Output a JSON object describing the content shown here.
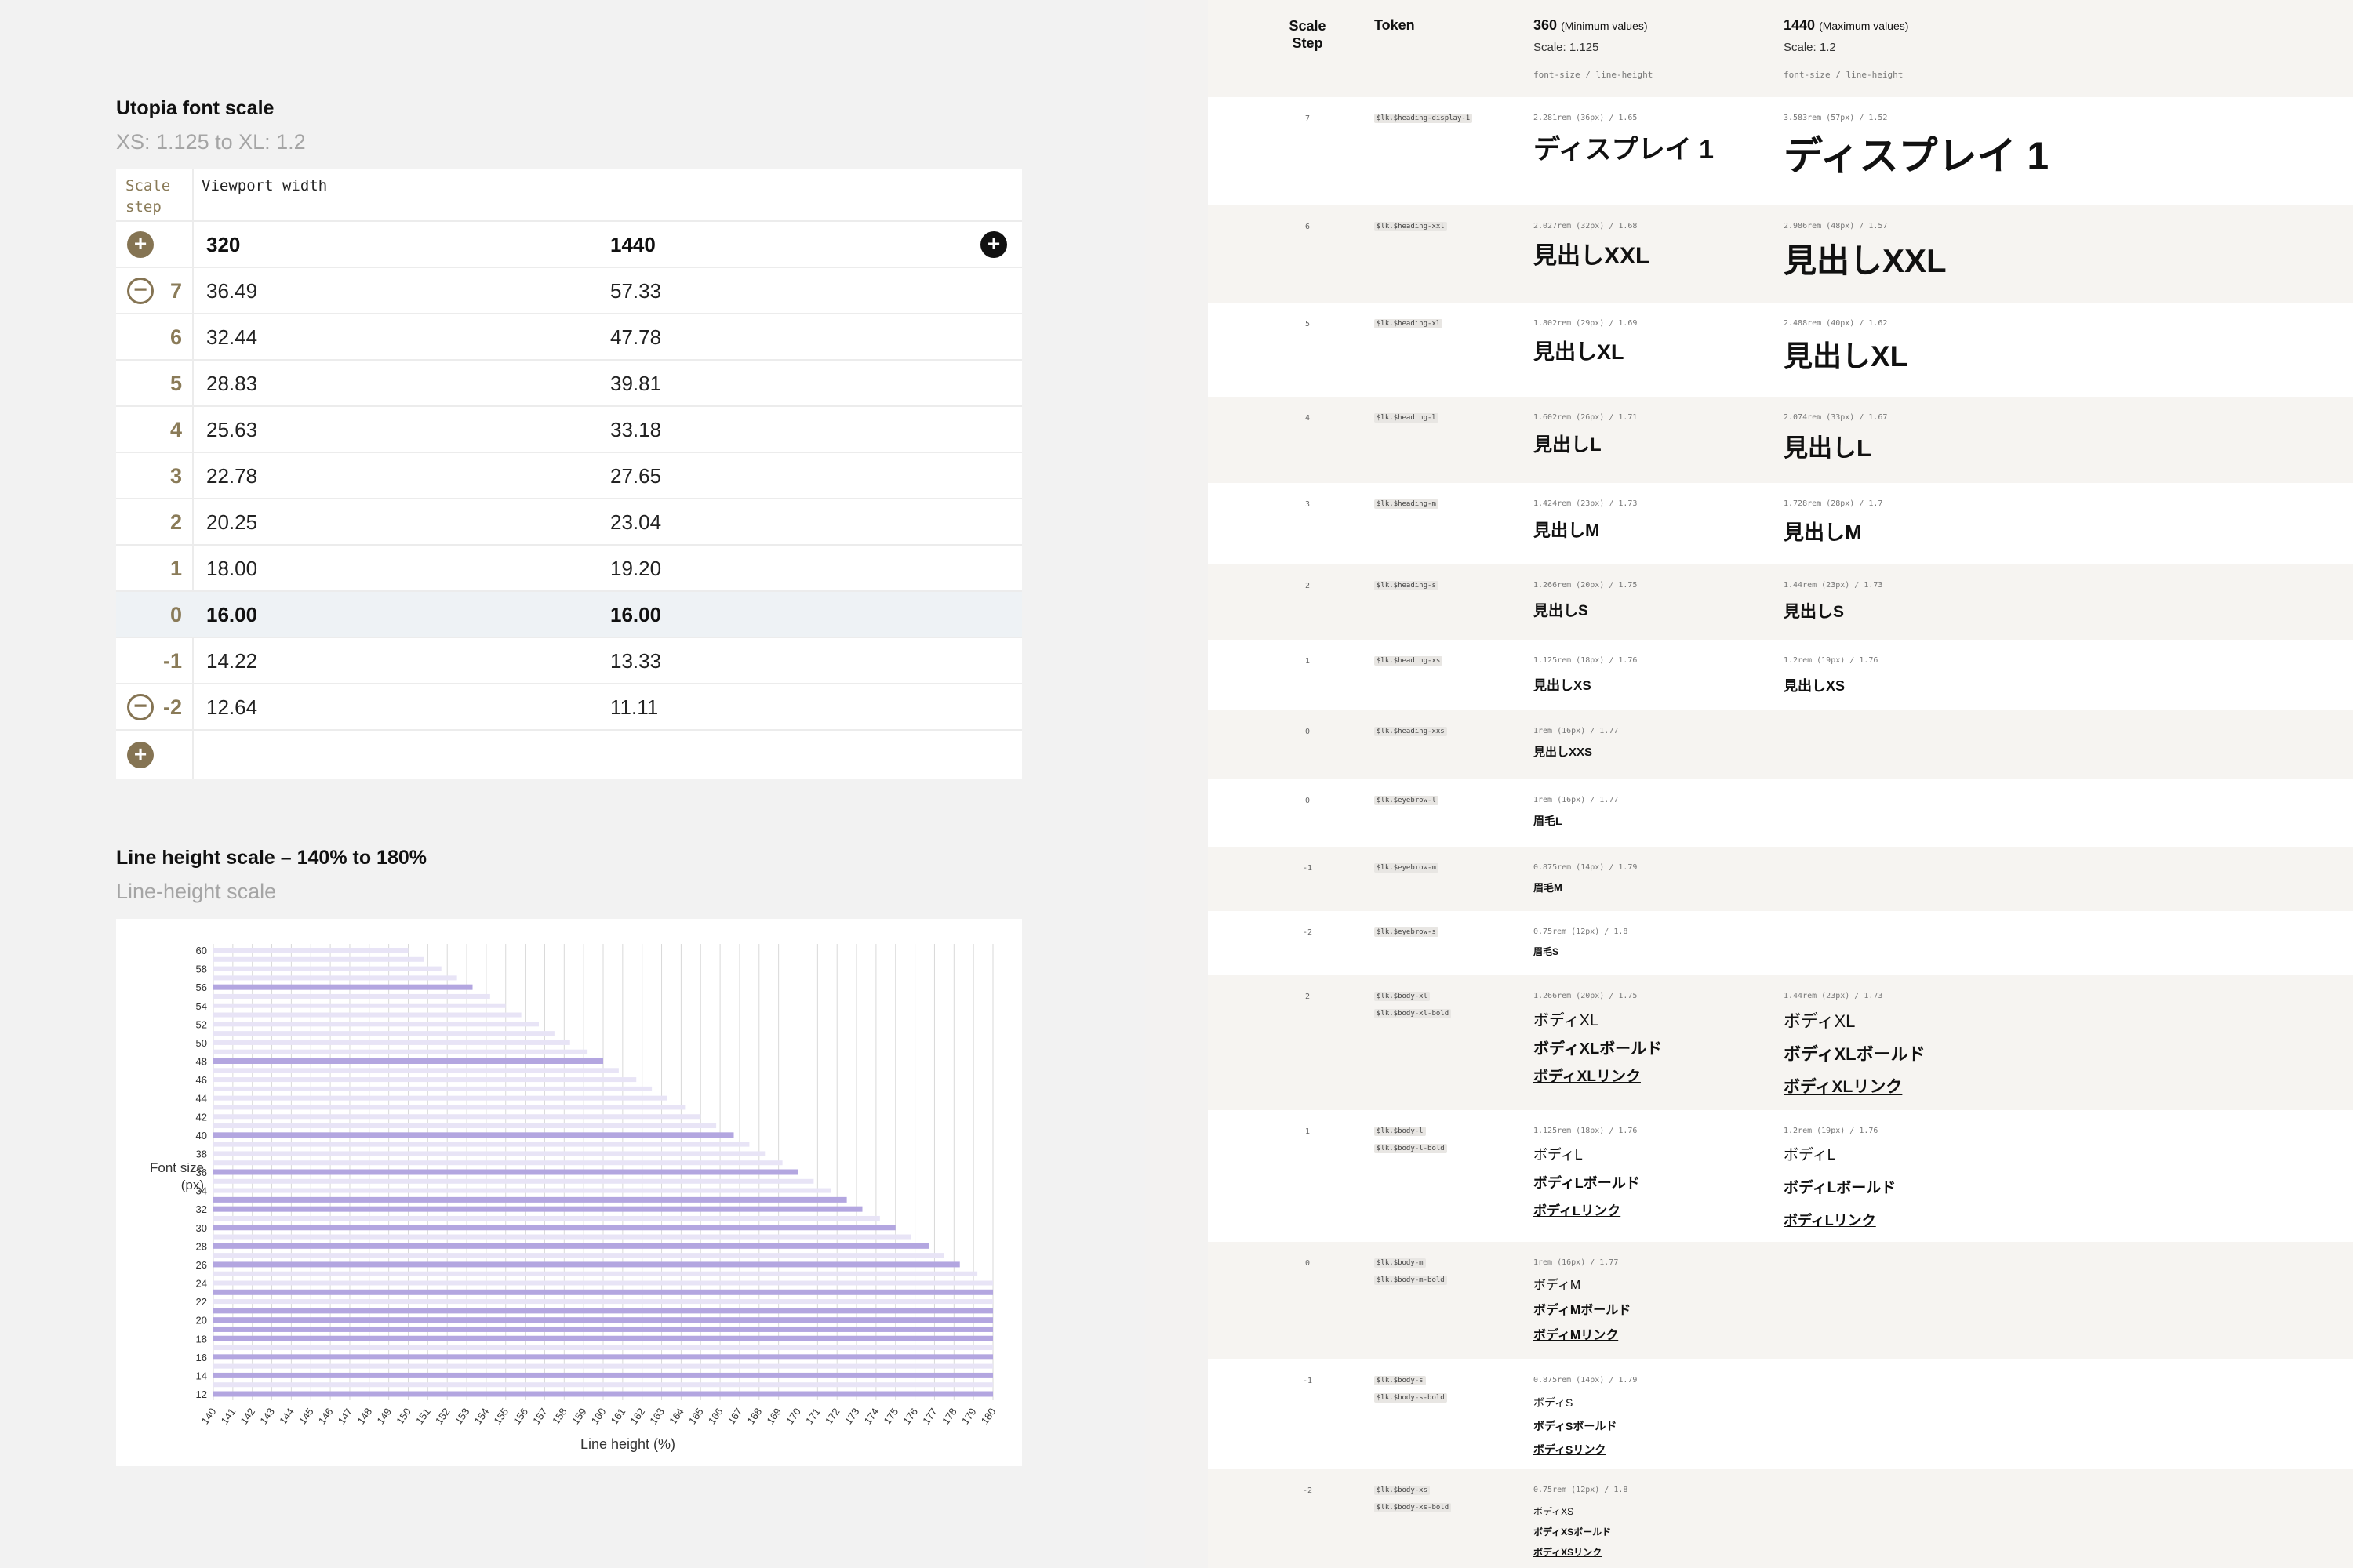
{
  "font_scale": {
    "title": "Utopia font scale",
    "subtitle": "XS: 1.125 to XL: 1.2",
    "header_step": "Scale step",
    "header_viewport": "Viewport width",
    "viewport_min": "320",
    "viewport_max": "1440",
    "rows": [
      {
        "step": "7",
        "min": "36.49",
        "max": "57.33"
      },
      {
        "step": "6",
        "min": "32.44",
        "max": "47.78"
      },
      {
        "step": "5",
        "min": "28.83",
        "max": "39.81"
      },
      {
        "step": "4",
        "min": "25.63",
        "max": "33.18"
      },
      {
        "step": "3",
        "min": "22.78",
        "max": "27.65"
      },
      {
        "step": "2",
        "min": "20.25",
        "max": "23.04"
      },
      {
        "step": "1",
        "min": "18.00",
        "max": "19.20"
      },
      {
        "step": "0",
        "min": "16.00",
        "max": "16.00"
      },
      {
        "step": "-1",
        "min": "14.22",
        "max": "13.33"
      },
      {
        "step": "-2",
        "min": "12.64",
        "max": "11.11"
      }
    ],
    "add_icon": "plus-icon",
    "remove_icon": "minus-icon",
    "accent_color": "#857453"
  },
  "line_height": {
    "title": "Line height scale – 140% to 180%",
    "subtitle": "Line-height scale"
  },
  "chart_data": {
    "type": "bar",
    "orientation": "horizontal",
    "title": "Line height scale – 140% to 180%",
    "xlabel": "Line height (%)",
    "ylabel": "Font size (px)",
    "xlim": [
      140,
      180
    ],
    "x_ticks": [
      "140",
      "141",
      "142",
      "143",
      "144",
      "145",
      "146",
      "147",
      "148",
      "149",
      "150",
      "151",
      "152",
      "153",
      "154",
      "155",
      "156",
      "157",
      "158",
      "159",
      "160",
      "161",
      "162",
      "163",
      "164",
      "165",
      "166",
      "167",
      "168",
      "169",
      "170",
      "171",
      "172",
      "173",
      "174",
      "175",
      "176",
      "177",
      "178",
      "179",
      "180"
    ],
    "y_ticks": [
      "60",
      "58",
      "56",
      "54",
      "52",
      "50",
      "48",
      "46",
      "44",
      "42",
      "40",
      "38",
      "36",
      "34",
      "32",
      "30",
      "28",
      "26",
      "24",
      "22",
      "20",
      "18",
      "16",
      "14",
      "12"
    ],
    "categories": [
      60,
      59,
      58,
      57,
      56,
      55,
      54,
      53,
      52,
      51,
      50,
      49,
      48,
      47,
      46,
      45,
      44,
      43,
      42,
      41,
      40,
      39,
      38,
      37,
      36,
      35,
      34,
      33,
      32,
      31,
      30,
      29,
      28,
      27,
      26,
      25,
      24,
      23,
      22,
      21,
      20,
      19,
      18,
      17,
      16,
      15,
      14,
      13,
      12
    ],
    "values": [
      150.0,
      150.8,
      151.7,
      152.5,
      153.3,
      154.2,
      155.0,
      155.8,
      156.7,
      157.5,
      158.3,
      159.2,
      160.0,
      160.8,
      161.7,
      162.5,
      163.3,
      164.2,
      165.0,
      165.8,
      166.7,
      167.5,
      168.3,
      169.2,
      170.0,
      170.8,
      171.7,
      172.5,
      173.3,
      174.2,
      175.0,
      175.8,
      176.7,
      177.5,
      178.3,
      179.2,
      180.0,
      180.0,
      180.0,
      180.0,
      180.0,
      180.0,
      180.0,
      180.0,
      180.0,
      180.0,
      180.0,
      180.0,
      180.0
    ],
    "highlighted": [
      56,
      48,
      40,
      36,
      33,
      32,
      30,
      28,
      26,
      23,
      21,
      20,
      19,
      18,
      16,
      14,
      12
    ],
    "bar_color": "#b3a6e0",
    "faint_bar_color": "#e8e4f6",
    "grid": true
  },
  "type_table": {
    "header": {
      "step": "Scale Step",
      "token": "Token",
      "min_width": "360",
      "min_label": "(Minimum values)",
      "min_scale": "Scale: 1.125",
      "max_width": "1440",
      "max_label": "(Maximum values)",
      "max_scale": "Scale: 1.2",
      "col_note": "font-size / line-height"
    },
    "rows": [
      {
        "step": "7",
        "tokens": [
          "$lk.$heading-display-1"
        ],
        "min_spec": "2.281rem (36px) / 1.65",
        "max_spec": "3.583rem (57px) / 1.52",
        "min": [
          "ディスプレイ 1"
        ],
        "max": [
          "ディスプレイ 1"
        ]
      },
      {
        "step": "6",
        "tokens": [
          "$lk.$heading-xxl"
        ],
        "min_spec": "2.027rem (32px) / 1.68",
        "max_spec": "2.986rem (48px) / 1.57",
        "min": [
          "見出しXXL"
        ],
        "max": [
          "見出しXXL"
        ]
      },
      {
        "step": "5",
        "tokens": [
          "$lk.$heading-xl"
        ],
        "min_spec": "1.802rem (29px) / 1.69",
        "max_spec": "2.488rem (40px) / 1.62",
        "min": [
          "見出しXL"
        ],
        "max": [
          "見出しXL"
        ]
      },
      {
        "step": "4",
        "tokens": [
          "$lk.$heading-l"
        ],
        "min_spec": "1.602rem (26px) / 1.71",
        "max_spec": "2.074rem (33px) / 1.67",
        "min": [
          "見出しL"
        ],
        "max": [
          "見出しL"
        ]
      },
      {
        "step": "3",
        "tokens": [
          "$lk.$heading-m"
        ],
        "min_spec": "1.424rem (23px) / 1.73",
        "max_spec": "1.728rem (28px) / 1.7",
        "min": [
          "見出しM"
        ],
        "max": [
          "見出しM"
        ]
      },
      {
        "step": "2",
        "tokens": [
          "$lk.$heading-s"
        ],
        "min_spec": "1.266rem (20px) / 1.75",
        "max_spec": "1.44rem (23px) / 1.73",
        "min": [
          "見出しS"
        ],
        "max": [
          "見出しS"
        ]
      },
      {
        "step": "1",
        "tokens": [
          "$lk.$heading-xs"
        ],
        "min_spec": "1.125rem (18px) / 1.76",
        "max_spec": "1.2rem (19px) / 1.76",
        "min": [
          "見出しXS"
        ],
        "max": [
          "見出しXS"
        ]
      },
      {
        "step": "0",
        "tokens": [
          "$lk.$heading-xxs"
        ],
        "min_spec": "1rem (16px) / 1.77",
        "max_spec": "",
        "min": [
          "見出しXXS"
        ],
        "max": []
      },
      {
        "step": "0",
        "tokens": [
          "$lk.$eyebrow-l"
        ],
        "min_spec": "1rem (16px) / 1.77",
        "max_spec": "",
        "min": [
          "眉毛L"
        ],
        "max": []
      },
      {
        "step": "-1",
        "tokens": [
          "$lk.$eyebrow-m"
        ],
        "min_spec": "0.875rem (14px) / 1.79",
        "max_spec": "",
        "min": [
          "眉毛M"
        ],
        "max": []
      },
      {
        "step": "-2",
        "tokens": [
          "$lk.$eyebrow-s"
        ],
        "min_spec": "0.75rem (12px) / 1.8",
        "max_spec": "",
        "min": [
          "眉毛S"
        ],
        "max": []
      },
      {
        "step": "2",
        "tokens": [
          "$lk.$body-xl",
          "$lk.$body-xl-bold"
        ],
        "min_spec": "1.266rem (20px) / 1.75",
        "max_spec": "1.44rem (23px) / 1.73",
        "min": [
          "ボディXL",
          "ボディXLボールド",
          "ボディXLリンク"
        ],
        "max": [
          "ボディXL",
          "ボディXLボールド",
          "ボディXLリンク"
        ]
      },
      {
        "step": "1",
        "tokens": [
          "$lk.$body-l",
          "$lk.$body-l-bold"
        ],
        "min_spec": "1.125rem (18px) / 1.76",
        "max_spec": "1.2rem (19px) / 1.76",
        "min": [
          "ボディL",
          "ボディLボールド",
          "ボディLリンク"
        ],
        "max": [
          "ボディL",
          "ボディLボールド",
          "ボディLリンク"
        ]
      },
      {
        "step": "0",
        "tokens": [
          "$lk.$body-m",
          "$lk.$body-m-bold"
        ],
        "min_spec": "1rem (16px) / 1.77",
        "max_spec": "",
        "min": [
          "ボディM",
          "ボディMボールド",
          "ボディMリンク"
        ],
        "max": []
      },
      {
        "step": "-1",
        "tokens": [
          "$lk.$body-s",
          "$lk.$body-s-bold"
        ],
        "min_spec": "0.875rem (14px) / 1.79",
        "max_spec": "",
        "min": [
          "ボディS",
          "ボディSボールド",
          "ボディSリンク"
        ],
        "max": []
      },
      {
        "step": "-2",
        "tokens": [
          "$lk.$body-xs",
          "$lk.$body-xs-bold"
        ],
        "min_spec": "0.75rem (12px) / 1.8",
        "max_spec": "",
        "min": [
          "ボディXS",
          "ボディXSボールド",
          "ボディXSリンク"
        ],
        "max": []
      }
    ]
  }
}
